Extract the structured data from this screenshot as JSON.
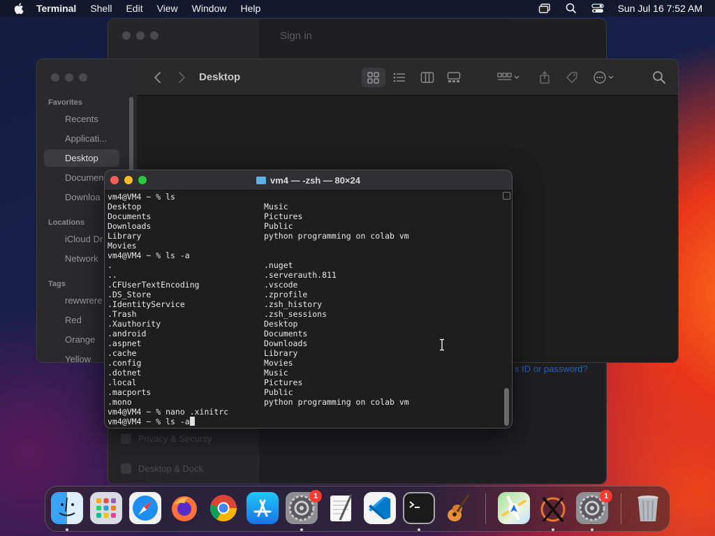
{
  "menubar": {
    "app_name": "Terminal",
    "items": [
      "Shell",
      "Edit",
      "View",
      "Window",
      "Help"
    ],
    "datetime": "Sun Jul 16  7:52 AM"
  },
  "settings_window": {
    "signin": "Sign in",
    "forgot_link": "s ID or password?",
    "rows": [
      "Privacy & Security",
      "Desktop & Dock"
    ]
  },
  "finder": {
    "title": "Desktop",
    "sidebar": {
      "favorites_header": "Favorites",
      "favorites": [
        "Recents",
        "Applicati...",
        "Desktop",
        "Documen",
        "Downloa"
      ],
      "locations_header": "Locations",
      "locations": [
        "iCloud Dr",
        "Network"
      ],
      "tags_header": "Tags",
      "tags": [
        "rewwrere",
        "Red",
        "Orange",
        "Yellow"
      ]
    }
  },
  "terminal": {
    "title": "vm4 — -zsh — 80×24",
    "lines": [
      {
        "left": "vm4@VM4 ~ % ls",
        "right": ""
      },
      {
        "left": "Desktop",
        "right": "Music"
      },
      {
        "left": "Documents",
        "right": "Pictures"
      },
      {
        "left": "Downloads",
        "right": "Public"
      },
      {
        "left": "Library",
        "right": "python programming on colab vm"
      },
      {
        "left": "Movies",
        "right": ""
      },
      {
        "left": "vm4@VM4 ~ % ls -a",
        "right": ""
      },
      {
        "left": ".",
        "right": ".nuget"
      },
      {
        "left": "..",
        "right": ".serverauth.811"
      },
      {
        "left": ".CFUserTextEncoding",
        "right": ".vscode"
      },
      {
        "left": ".DS_Store",
        "right": ".zprofile"
      },
      {
        "left": ".IdentityService",
        "right": ".zsh_history"
      },
      {
        "left": ".Trash",
        "right": ".zsh_sessions"
      },
      {
        "left": ".Xauthority",
        "right": "Desktop"
      },
      {
        "left": ".android",
        "right": "Documents"
      },
      {
        "left": ".aspnet",
        "right": "Downloads"
      },
      {
        "left": ".cache",
        "right": "Library"
      },
      {
        "left": ".config",
        "right": "Movies"
      },
      {
        "left": ".dotnet",
        "right": "Music"
      },
      {
        "left": ".local",
        "right": "Pictures"
      },
      {
        "left": ".macports",
        "right": "Public"
      },
      {
        "left": ".mono",
        "right": "python programming on colab vm"
      },
      {
        "left": "vm4@VM4 ~ % nano .xinitrc",
        "right": ""
      }
    ],
    "current_line": "vm4@VM4 ~ % ls -a"
  },
  "dock": {
    "badge_settings": "1",
    "badge_settings2": "1",
    "apps": [
      "finder-icon",
      "launchpad-icon",
      "safari-icon",
      "firefox-icon",
      "chrome-icon",
      "app-store-icon",
      "system-settings-icon",
      "textedit-icon",
      "vscode-icon",
      "terminal-icon",
      "garageband-icon",
      "maps-icon",
      "x11-icon",
      "system-settings-icon",
      "trash-icon"
    ]
  }
}
